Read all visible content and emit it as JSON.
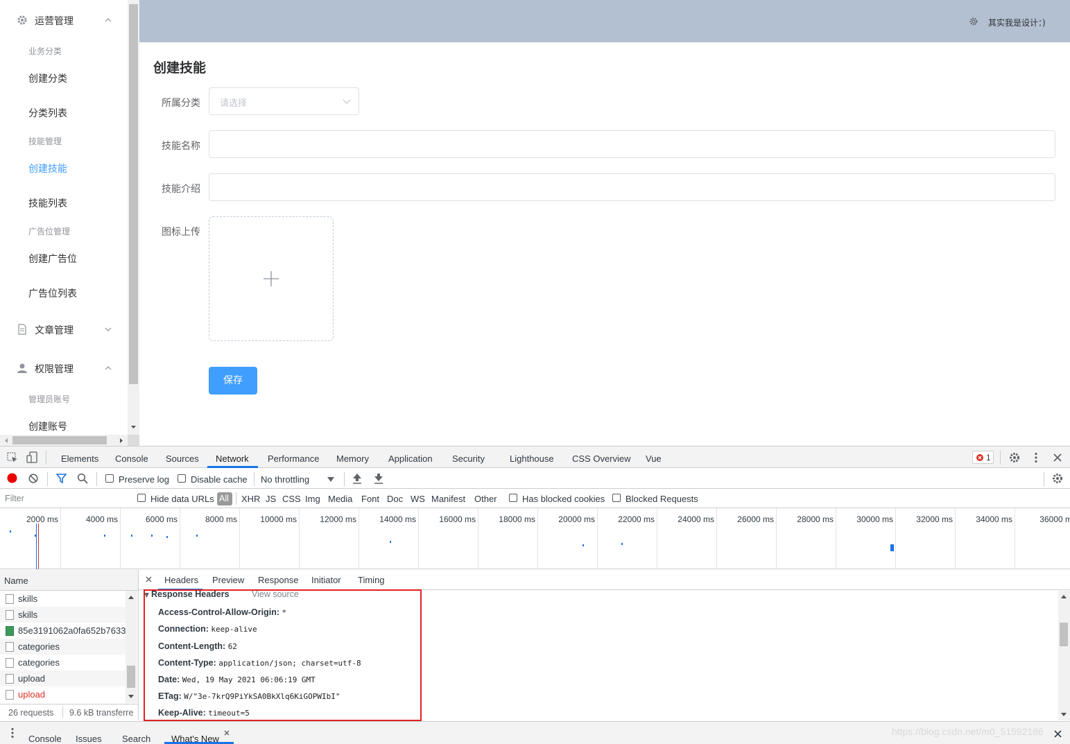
{
  "sidebar": {
    "groups": [
      {
        "label": "运营管理",
        "icon": "gear-icon",
        "expanded": true
      },
      {
        "label": "文章管理",
        "icon": "document-icon",
        "expanded": false
      },
      {
        "label": "权限管理",
        "icon": "user-icon",
        "expanded": true
      }
    ],
    "sub_titles": [
      "业务分类",
      "技能管理",
      "广告位管理",
      "管理员账号"
    ],
    "items": [
      "创建分类",
      "分类列表",
      "创建技能",
      "技能列表",
      "创建广告位",
      "广告位列表",
      "创建账号"
    ],
    "active_item": "创建技能"
  },
  "header": {
    "user_text": "其实我是设计：)",
    "icon": "settings-icon"
  },
  "main": {
    "title": "创建技能",
    "form": {
      "category_label": "所属分类",
      "category_placeholder": "请选择",
      "name_label": "技能名称",
      "intro_label": "技能介绍",
      "icon_label": "图标上传",
      "save_label": "保存"
    }
  },
  "devtools": {
    "tabs": [
      "Elements",
      "Console",
      "Sources",
      "Network",
      "Performance",
      "Memory",
      "Application",
      "Security",
      "Lighthouse",
      "CSS Overview",
      "Vue"
    ],
    "active_tab": "Network",
    "error_count": "1",
    "toolbar": {
      "preserve_log": "Preserve log",
      "disable_cache": "Disable cache",
      "throttling": "No throttling"
    },
    "filter": {
      "placeholder": "Filter",
      "hide_data_urls": "Hide data URLs",
      "types": [
        "All",
        "XHR",
        "JS",
        "CSS",
        "Img",
        "Media",
        "Font",
        "Doc",
        "WS",
        "Manifest",
        "Other"
      ],
      "has_blocked_cookies": "Has blocked cookies",
      "blocked_requests": "Blocked Requests"
    },
    "timeline_ticks": [
      "2000 ms",
      "4000 ms",
      "6000 ms",
      "8000 ms",
      "10000 ms",
      "12000 ms",
      "14000 ms",
      "16000 ms",
      "18000 ms",
      "20000 ms",
      "22000 ms",
      "24000 ms",
      "26000 ms",
      "28000 ms",
      "30000 ms",
      "32000 ms",
      "34000 ms",
      "36000 m"
    ],
    "name_header": "Name",
    "requests": [
      {
        "name": "skills",
        "error": false
      },
      {
        "name": "skills",
        "error": false
      },
      {
        "name": "85e3191062a0fa652b7633",
        "error": false
      },
      {
        "name": "categories",
        "error": false
      },
      {
        "name": "categories",
        "error": false
      },
      {
        "name": "upload",
        "error": false
      },
      {
        "name": "upload",
        "error": true
      }
    ],
    "status": {
      "requests": "26 requests",
      "transferred": "9.6 kB transferre"
    },
    "detail_tabs": [
      "Headers",
      "Preview",
      "Response",
      "Initiator",
      "Timing"
    ],
    "response_headers_title": "Response Headers",
    "view_source": "View source",
    "headers": [
      {
        "key": "Access-Control-Allow-Origin:",
        "value": "*"
      },
      {
        "key": "Connection:",
        "value": "keep-alive"
      },
      {
        "key": "Content-Length:",
        "value": "62"
      },
      {
        "key": "Content-Type:",
        "value": "application/json; charset=utf-8"
      },
      {
        "key": "Date:",
        "value": "Wed, 19 May 2021 06:06:19 GMT"
      },
      {
        "key": "ETag:",
        "value": "W/\"3e-7krQ9PiYkSA0BkXlq6KiGOPWIbI\""
      },
      {
        "key": "Keep-Alive:",
        "value": "timeout=5"
      }
    ],
    "drawer_tabs": [
      "Console",
      "Issues",
      "Search",
      "What's New"
    ],
    "watermark": "https://blog.csdn.net/m0_51592186"
  }
}
